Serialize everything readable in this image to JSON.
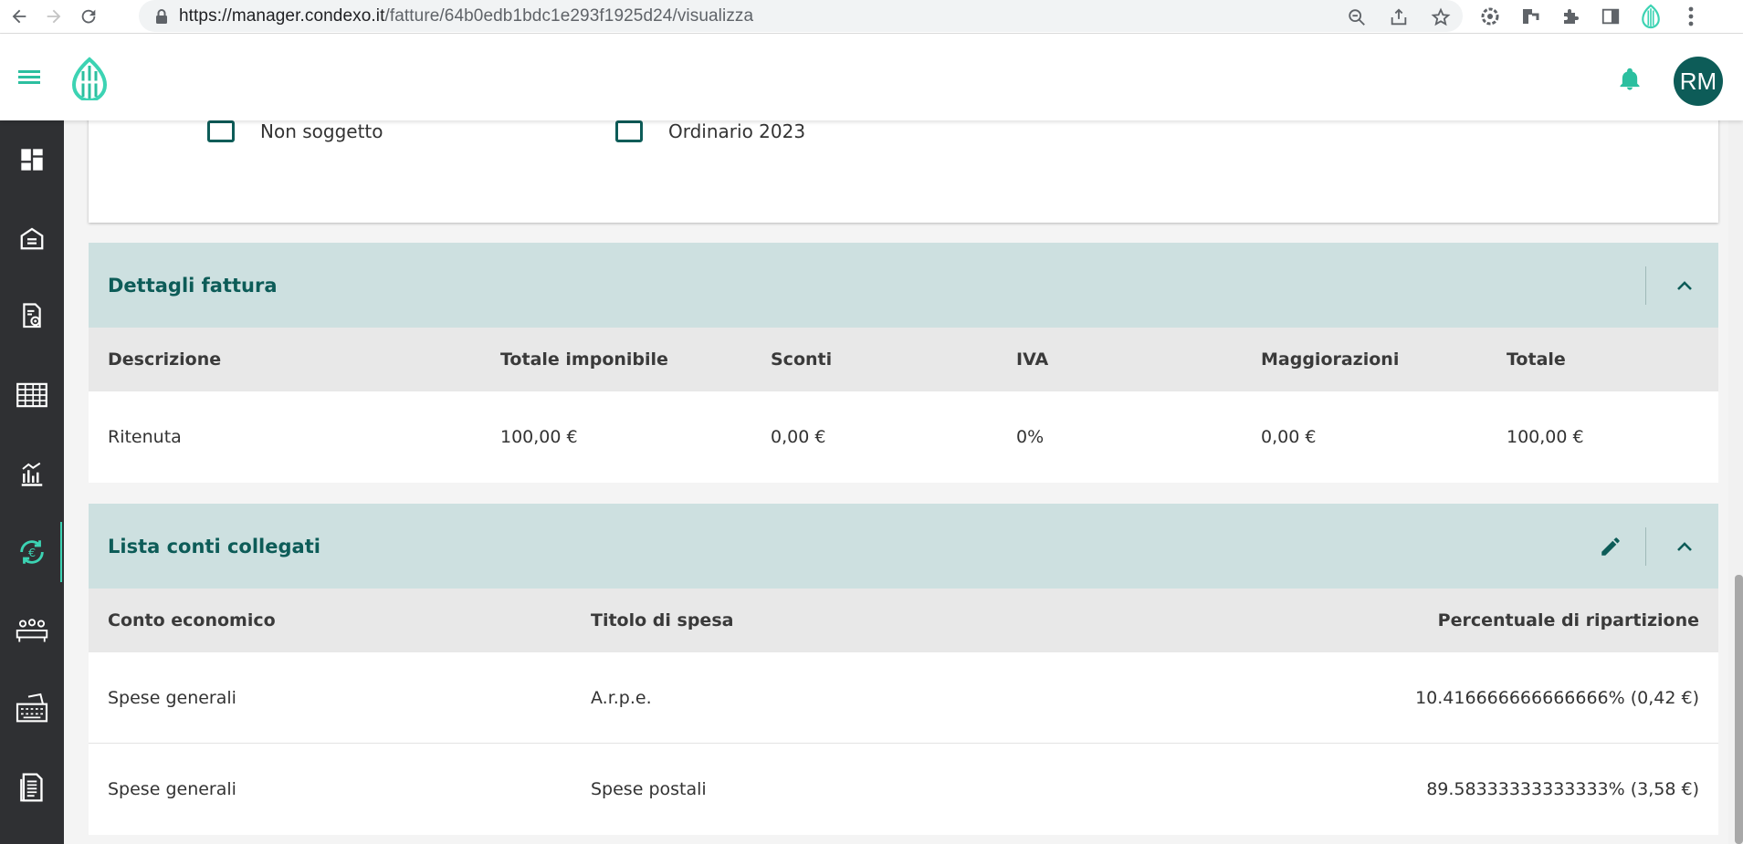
{
  "browser": {
    "url_host": "https://manager.condexo.it",
    "url_path": "/fatture/64b0edb1bdc1e293f1925d24/visualizza"
  },
  "header": {
    "avatar_initials": "RM"
  },
  "top_card": {
    "item1": "Non soggetto",
    "item2": "Ordinario 2023"
  },
  "invoice_details": {
    "title": "Dettagli fattura",
    "columns": [
      "Descrizione",
      "Totale imponibile",
      "Sconti",
      "IVA",
      "Maggiorazioni",
      "Totale"
    ],
    "rows": [
      [
        "Ritenuta",
        "100,00 €",
        "0,00 €",
        "0%",
        "0,00 €",
        "100,00 €"
      ]
    ]
  },
  "linked_accounts": {
    "title": "Lista conti collegati",
    "columns": [
      "Conto economico",
      "Titolo di spesa",
      "Percentuale di ripartizione"
    ],
    "rows": [
      [
        "Spese generali",
        "A.r.p.e.",
        "10.416666666666666% (0,42 €)"
      ],
      [
        "Spese generali",
        "Spese postali",
        "89.58333333333333% (3,58 €)"
      ]
    ]
  },
  "colors": {
    "brand": "#0d5c58",
    "accent": "#3cd3b3",
    "section_header_bg": "#cde0e0",
    "sidebar_bg": "#2f3033"
  },
  "icons": {
    "sidebar": [
      "dashboard-icon",
      "building-icon",
      "document-settings-icon",
      "table-icon",
      "bank-chart-icon",
      "euro-cycle-icon",
      "people-table-icon",
      "ticket-icon",
      "document-list-icon"
    ]
  }
}
